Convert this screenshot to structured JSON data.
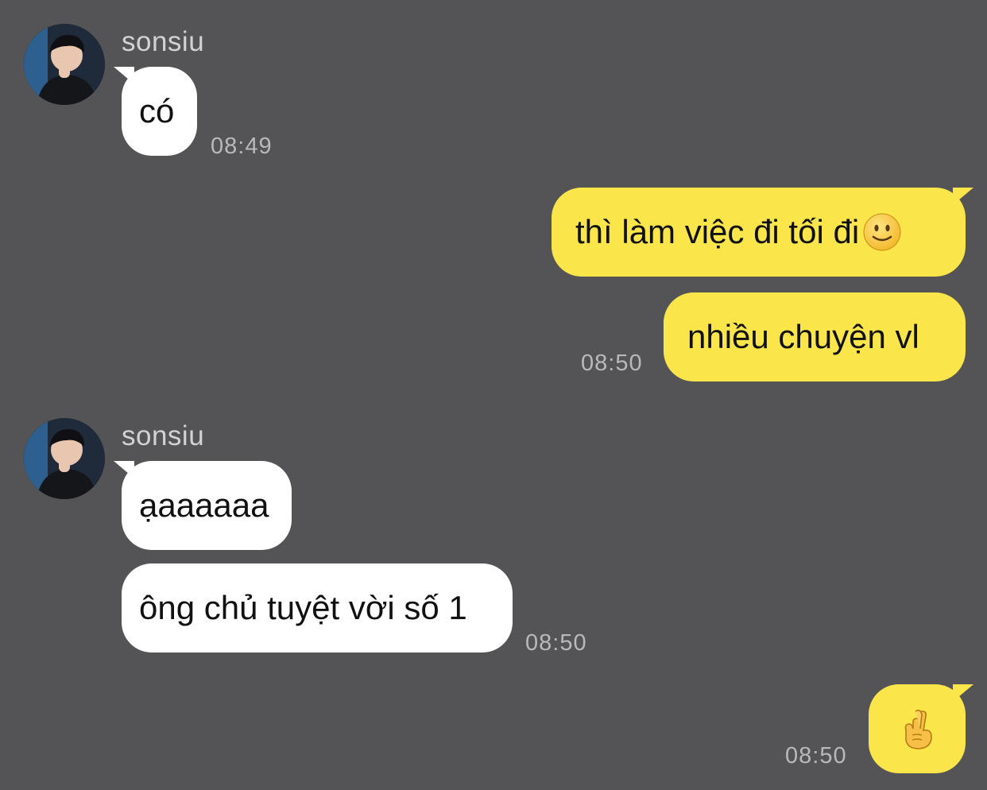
{
  "colors": {
    "background": "#545355",
    "incoming_bubble": "#ffffff",
    "outgoing_bubble": "#fae54b",
    "timestamp": "#b9b8ba",
    "sender_name": "#d2d1d3"
  },
  "messages": [
    {
      "group": 1,
      "direction": "incoming",
      "sender": "sonsiu",
      "text": "có",
      "time": "08:49"
    },
    {
      "group": 2,
      "direction": "outgoing",
      "text": "thì làm việc đi tối đi",
      "emoji": "slightly-smiling-face-icon"
    },
    {
      "group": 2,
      "direction": "outgoing",
      "text": "nhiều chuyện vl",
      "time": "08:50"
    },
    {
      "group": 3,
      "direction": "incoming",
      "sender": "sonsiu",
      "text": "ạaaaaaa"
    },
    {
      "group": 3,
      "direction": "incoming",
      "text": "ông chủ tuyệt vời số 1",
      "time": "08:50"
    },
    {
      "group": 4,
      "direction": "outgoing",
      "emoji": "crossed-fingers-icon",
      "time": "08:50"
    }
  ]
}
